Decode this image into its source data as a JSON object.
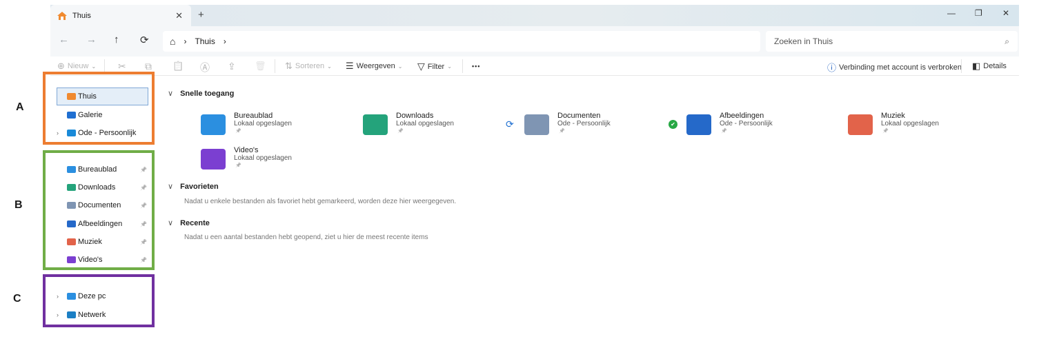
{
  "window": {
    "tab_title": "Thuis",
    "tab_close": "✕",
    "new_tab": "+",
    "minimize": "—",
    "restore": "❐",
    "close": "✕"
  },
  "address": {
    "back": "←",
    "forward": "→",
    "up": "↑",
    "refresh": "⟳",
    "home_icon": "⌂",
    "sep1": "›",
    "crumb": "Thuis",
    "sep2": "›",
    "search_placeholder": "Zoeken in Thuis",
    "search_icon": "⌕"
  },
  "toolbar": {
    "new_label": "Nieuw",
    "sort_label": "Sorteren",
    "view_label": "Weergeven",
    "filter_label": "Filter",
    "more": "•••",
    "account_warning": "Verbinding met account is verbroken",
    "details_label": "Details",
    "caret": "⌄",
    "icons": {
      "new": "⊕",
      "cut": "✂",
      "copy": "⧉",
      "paste": "📋",
      "rename": "Ⓐ",
      "share": "⇪",
      "delete": "🗑",
      "sort": "⇅",
      "view": "☰",
      "filter": "▽",
      "info": "ⓘ",
      "details": "◧"
    }
  },
  "sidebar": {
    "top": [
      {
        "label": "Thuis",
        "icon": "home-icon",
        "color": "#f08a30",
        "selected": true
      },
      {
        "label": "Galerie",
        "icon": "gallery-icon",
        "color": "#1f6fd1"
      },
      {
        "label": "Ode - Persoonlijk",
        "icon": "onedrive-folder-icon",
        "color": "#1a8ad8",
        "expandable": true
      }
    ],
    "pinned": [
      {
        "label": "Bureaublad",
        "icon": "desktop-folder-icon",
        "color": "#2b8fe0"
      },
      {
        "label": "Downloads",
        "icon": "downloads-folder-icon",
        "color": "#24a37b"
      },
      {
        "label": "Documenten",
        "icon": "documents-folder-icon",
        "color": "#7f95b3"
      },
      {
        "label": "Afbeeldingen",
        "icon": "pictures-folder-icon",
        "color": "#2569c9"
      },
      {
        "label": "Muziek",
        "icon": "music-folder-icon",
        "color": "#e2634a"
      },
      {
        "label": "Video's",
        "icon": "videos-folder-icon",
        "color": "#7b3fd1"
      }
    ],
    "bottom": [
      {
        "label": "Deze pc",
        "icon": "pc-icon",
        "color": "#2b8fe0"
      },
      {
        "label": "Netwerk",
        "icon": "network-icon",
        "color": "#1c7fc4"
      }
    ],
    "chevron": "›",
    "pin": "📌"
  },
  "content": {
    "quick_access_title": "Snelle toegang",
    "favorites_title": "Favorieten",
    "favorites_empty": "Nadat u enkele bestanden als favoriet hebt gemarkeerd, worden deze hier weergegeven.",
    "recent_title": "Recente",
    "recent_empty": "Nadat u een aantal bestanden hebt geopend, ziet u hier de meest recente items",
    "section_chevron": "∨",
    "quick_access": [
      {
        "name": "Bureaublad",
        "sub": "Lokaal opgeslagen",
        "color": "#2b8fe0"
      },
      {
        "name": "Downloads",
        "sub": "Lokaal opgeslagen",
        "color": "#24a37b"
      },
      {
        "name": "Documenten",
        "sub": "Ode - Persoonlijk",
        "color": "#7f95b3",
        "status": "sync"
      },
      {
        "name": "Afbeeldingen",
        "sub": "Ode - Persoonlijk",
        "color": "#2569c9",
        "status": "ok"
      },
      {
        "name": "Muziek",
        "sub": "Lokaal opgeslagen",
        "color": "#e2634a"
      },
      {
        "name": "Video's",
        "sub": "Lokaal opgeslagen",
        "color": "#7b3fd1"
      }
    ],
    "status_icons": {
      "sync": "⟳",
      "ok": "✔"
    }
  },
  "annotations": {
    "label_a": "A",
    "label_b": "B",
    "label_c": "C",
    "color_a": "#ed7d31",
    "color_b": "#70ad47",
    "color_c": "#7030a0"
  }
}
